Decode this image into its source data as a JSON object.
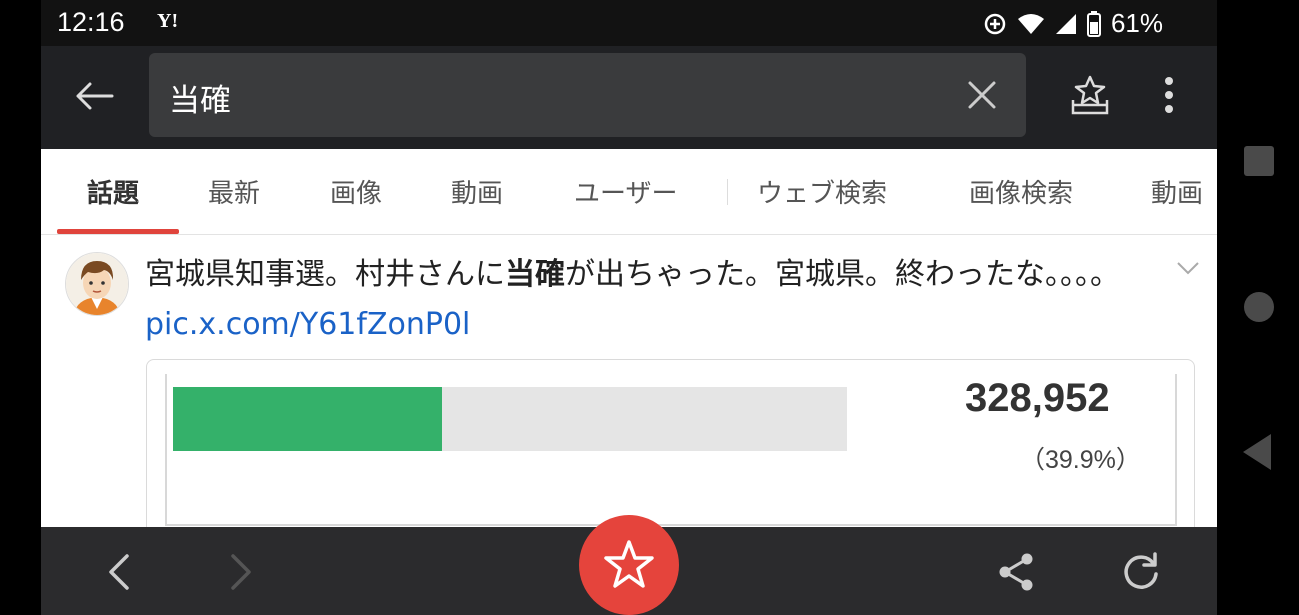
{
  "status_bar": {
    "time": "12:16",
    "app_icon_text": "Y!",
    "battery_percent": "61%"
  },
  "search": {
    "query": "当確"
  },
  "tabs": [
    {
      "label": "話題",
      "active": true
    },
    {
      "label": "最新",
      "active": false
    },
    {
      "label": "画像",
      "active": false
    },
    {
      "label": "動画",
      "active": false
    },
    {
      "label": "ユーザー",
      "active": false
    },
    {
      "label": "ウェブ検索",
      "active": false
    },
    {
      "label": "画像検索",
      "active": false
    },
    {
      "label": "動画",
      "active": false
    }
  ],
  "tweet": {
    "text_before": "宮城県知事選。村井さんに",
    "text_highlight": "当確",
    "text_after": "が出ちゃった。宮城県。終わったな。。。。",
    "link": "pic.x.com/Y61fZonP0l"
  },
  "card": {
    "votes": "328,952",
    "percent_label": "（39.9%）",
    "bar_fraction": 0.399
  },
  "colors": {
    "accent": "#e5443c",
    "bar_fill": "#34b16a",
    "link": "#1a62c7"
  },
  "icons": {
    "back": "arrow-left-icon",
    "clear": "close-icon",
    "save": "save-tray-icon",
    "menu": "more-vert-icon",
    "favorite": "star-icon",
    "share": "share-icon",
    "reload": "reload-icon"
  }
}
